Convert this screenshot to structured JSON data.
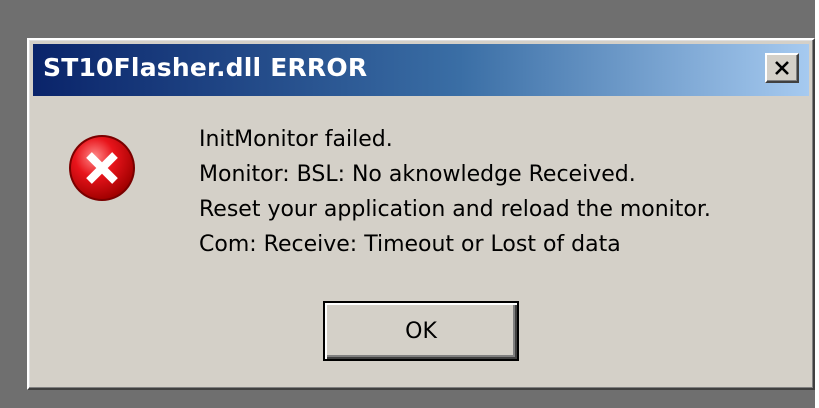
{
  "window": {
    "title": "ST10Flasher.dll ERROR",
    "close_icon": "close-icon",
    "titlebar_color_start": "#0a246a",
    "titlebar_color_end": "#a6caf0",
    "face_color": "#d4d0c8"
  },
  "icon": {
    "name": "error-icon",
    "color": "#e8141b"
  },
  "message": {
    "lines": [
      "InitMonitor failed.",
      "Monitor: BSL: No aknowledge Received.",
      "Reset your application and reload the monitor.",
      "Com: Receive: Timeout or Lost of data"
    ]
  },
  "buttons": {
    "ok_label": "OK"
  }
}
